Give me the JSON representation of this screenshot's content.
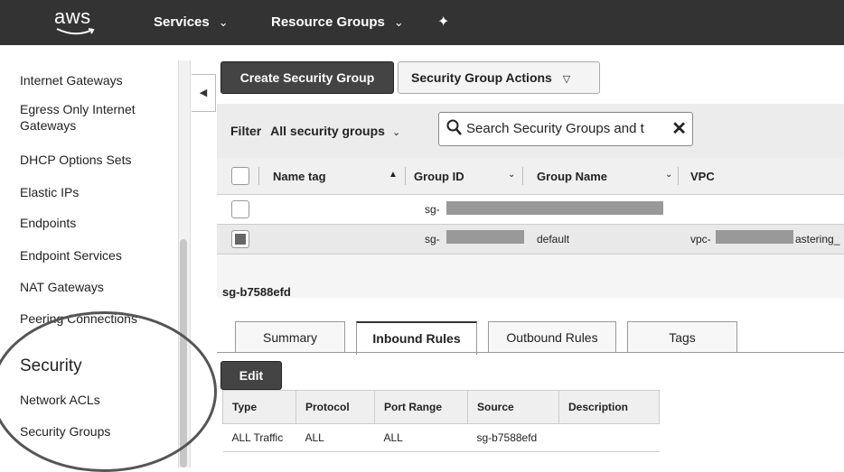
{
  "topbar": {
    "logo": "aws",
    "services": "Services",
    "resource_groups": "Resource Groups",
    "pin_icon": "pin-icon"
  },
  "sidebar": {
    "items": [
      "Internet Gateways",
      "Egress Only Internet",
      "Gateways",
      "DHCP Options Sets",
      "Elastic IPs",
      "Endpoints",
      "Endpoint Services",
      "NAT Gateways",
      "Peering Connections"
    ],
    "security_heading": "Security",
    "security_items": [
      "Network ACLs",
      "Security Groups"
    ]
  },
  "toolbar": {
    "create": "Create Security Group",
    "actions": "Security Group Actions"
  },
  "filter": {
    "label": "Filter",
    "value": "All security groups",
    "search_text": "Search Security Groups and t"
  },
  "table": {
    "headers": [
      "Name tag",
      "Group ID",
      "Group Name",
      "VPC"
    ],
    "rows": [
      {
        "group_id": "sg-",
        "group_name": "",
        "vpc": ""
      },
      {
        "group_id": "sg-",
        "group_name": "default",
        "vpc": "vpc-",
        "vpc_suffix": "astering_"
      }
    ]
  },
  "detail": {
    "id": "sg-b7588efd",
    "tabs": [
      "Summary",
      "Inbound Rules",
      "Outbound Rules",
      "Tags"
    ],
    "edit": "Edit",
    "rules_headers": [
      "Type",
      "Protocol",
      "Port Range",
      "Source",
      "Description"
    ],
    "rules_rows": [
      {
        "type": "ALL Traffic",
        "protocol": "ALL",
        "port_range": "ALL",
        "source": "sg-b7588efd",
        "description": ""
      }
    ]
  }
}
